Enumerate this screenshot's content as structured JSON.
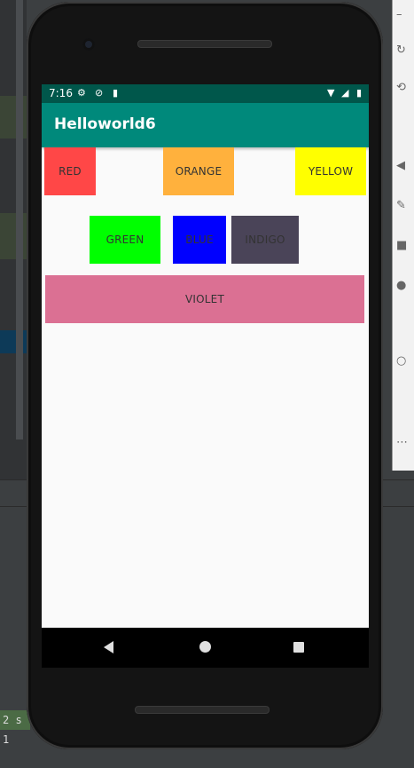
{
  "status_bar": {
    "time": "7:16"
  },
  "app_bar": {
    "title": "Helloworld6"
  },
  "buttons": {
    "red": {
      "label": "RED",
      "color": "#ff4747"
    },
    "orange": {
      "label": "ORANGE",
      "color": "#ffb13d"
    },
    "yellow": {
      "label": "YELLOW",
      "color": "#ffff00"
    },
    "green": {
      "label": "GREEN",
      "color": "#00ff00"
    },
    "blue": {
      "label": "BLUE",
      "color": "#0000ff"
    },
    "indigo": {
      "label": "INDIGO",
      "color": "#4a4458"
    },
    "violet": {
      "label": "VIOLET",
      "color": "#db7093"
    }
  },
  "ide": {
    "status_text": "2 s 1"
  },
  "colors": {
    "app_bar": "#00897b",
    "status_bar": "#00574b",
    "screen_bg": "#fafafa"
  }
}
